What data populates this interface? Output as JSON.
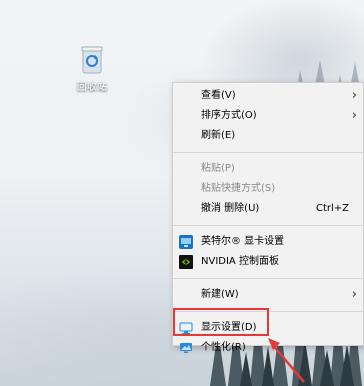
{
  "desktop": {
    "icon_label": "回收站",
    "icon_name": "recycle-bin-icon"
  },
  "context_menu": {
    "items": [
      {
        "label": "查看(V)",
        "submenu": true
      },
      {
        "label": "排序方式(O)",
        "submenu": true
      },
      {
        "label": "刷新(E)"
      },
      {
        "label": "粘贴(P)",
        "disabled": true
      },
      {
        "label": "粘贴快捷方式(S)",
        "disabled": true
      },
      {
        "label": "撤消 删除(U)",
        "shortcut": "Ctrl+Z"
      },
      {
        "label": "英特尔® 显卡设置",
        "icon": "intel-graphics-icon"
      },
      {
        "label": "NVIDIA 控制面板",
        "icon": "nvidia-icon"
      },
      {
        "label": "新建(W)",
        "submenu": true
      },
      {
        "label": "显示设置(D)",
        "icon": "display-settings-icon"
      },
      {
        "label": "个性化(R)",
        "icon": "personalize-icon"
      }
    ]
  },
  "annotation": {
    "highlight_color": "#e53935"
  }
}
